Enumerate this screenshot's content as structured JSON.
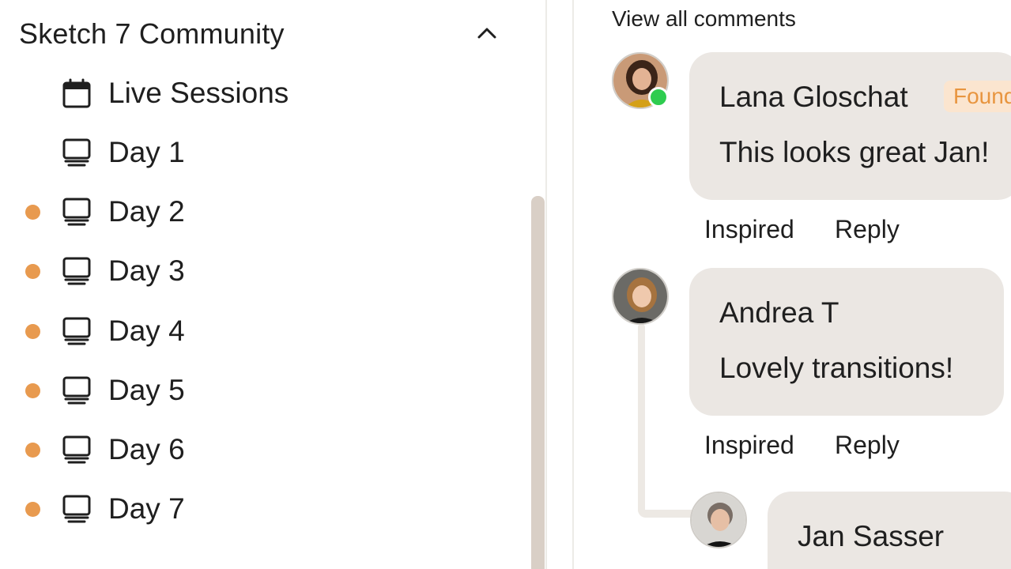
{
  "sidebar": {
    "section_title": "Sketch 7 Community",
    "items": [
      {
        "label": "Live Sessions",
        "icon": "calendar-icon",
        "unread": false
      },
      {
        "label": "Day 1",
        "icon": "monitor-icon",
        "unread": false
      },
      {
        "label": "Day 2",
        "icon": "monitor-icon",
        "unread": true
      },
      {
        "label": "Day 3",
        "icon": "monitor-icon",
        "unread": true
      },
      {
        "label": "Day 4",
        "icon": "monitor-icon",
        "unread": true
      },
      {
        "label": "Day 5",
        "icon": "monitor-icon",
        "unread": true
      },
      {
        "label": "Day 6",
        "icon": "monitor-icon",
        "unread": true
      },
      {
        "label": "Day 7",
        "icon": "monitor-icon",
        "unread": true
      }
    ],
    "unread_color": "#e89a4f"
  },
  "comments": {
    "view_all_label": "View all comments",
    "list": [
      {
        "author": "Lana Gloschat",
        "badge": "Founder",
        "text": "This looks great Jan!",
        "actions": [
          "Inspired",
          "Reply"
        ],
        "online": true
      },
      {
        "author": "Andrea T",
        "badge": "",
        "text": "Lovely transitions!",
        "actions": [
          "Inspired",
          "Reply"
        ],
        "online": false
      },
      {
        "author": "Jan Sasser",
        "badge": "",
        "text": "",
        "actions": [],
        "online": false
      }
    ],
    "bubble_color": "#ebe7e3",
    "badge_text_color": "#e8953f",
    "online_color": "#2ecc4f"
  }
}
